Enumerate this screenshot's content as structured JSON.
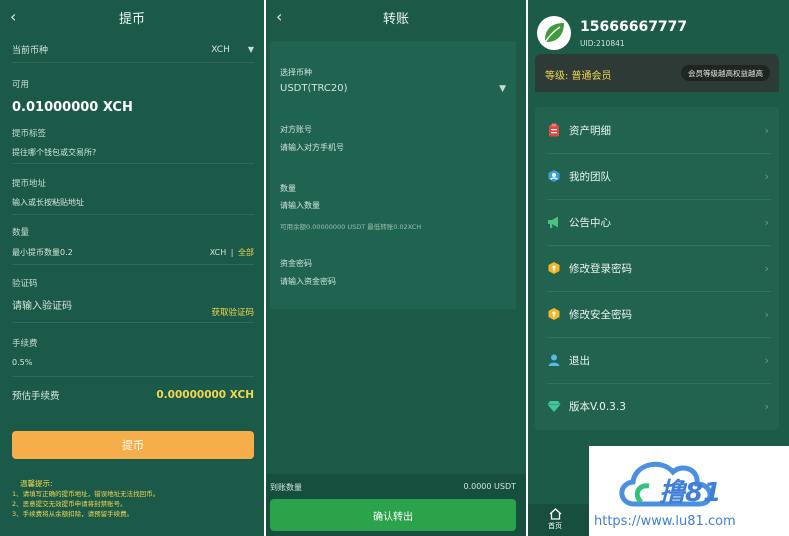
{
  "withdraw": {
    "title": "提币",
    "current_coin_label": "当前币种",
    "current_coin_value": "XCH",
    "available_label": "可用",
    "available_value": "0.01000000 XCH",
    "tag_label": "提币标签",
    "tag_placeholder": "提往哪个钱包或交易所?",
    "address_label": "提币地址",
    "address_placeholder": "输入或长按粘贴地址",
    "qty_label": "数量",
    "qty_placeholder": "最小提币数量0.2",
    "qty_unit": "XCH",
    "qty_divider": "|",
    "qty_all": "全部",
    "code_label": "验证码",
    "code_placeholder": "请输入验证码",
    "get_code": "获取验证码",
    "fee_label": "手续费",
    "fee_value": "0.5%",
    "est_fee_label": "预估手续费",
    "est_fee_value": "0.00000000 XCH",
    "submit": "提币",
    "tips_title": "温馨提示:",
    "tips": [
      "1、请填写正确的提币地址，错误地址无法找回币。",
      "2、恶意提交无效提币申请将封禁账号。",
      "3、手续费将从余额扣除，请预留手续费。"
    ]
  },
  "transfer": {
    "title": "转账",
    "coin_label": "选择币种",
    "coin_value": "USDT(TRC20)",
    "account_label": "对方账号",
    "account_placeholder": "请输入对方手机号",
    "qty_label": "数量",
    "qty_placeholder": "请输入数量",
    "qty_hint": "可用余额0.00000000 USDT 最低转账0.02XCH",
    "pwd_label": "资金密码",
    "pwd_placeholder": "请输入资金密码",
    "arrive_label": "到账数量",
    "arrive_value": "0.0000 USDT",
    "confirm": "确认转出"
  },
  "profile": {
    "phone": "15666667777",
    "uid": "UID:210841",
    "level_label": "等级: 普通会员",
    "level_button": "会员等级越高权益越高",
    "menu": [
      {
        "label": "资产明细",
        "icon": "clipboard-icon",
        "color": "#e0473f"
      },
      {
        "label": "我的团队",
        "icon": "team-icon",
        "color": "#3aa0e0"
      },
      {
        "label": "公告中心",
        "icon": "megaphone-icon",
        "color": "#4fc27a"
      },
      {
        "label": "修改登录密码",
        "icon": "shield-key-icon",
        "color": "#f3b52a"
      },
      {
        "label": "修改安全密码",
        "icon": "shield-key-icon",
        "color": "#f3b52a"
      },
      {
        "label": "退出",
        "icon": "user-icon",
        "color": "#58b8e8"
      },
      {
        "label": "版本V.0.3.3",
        "icon": "diamond-icon",
        "color": "#45c49a"
      }
    ],
    "tab_home": "首页"
  },
  "watermark": {
    "brand": "撸81",
    "url": "https://www.lu81.com"
  }
}
